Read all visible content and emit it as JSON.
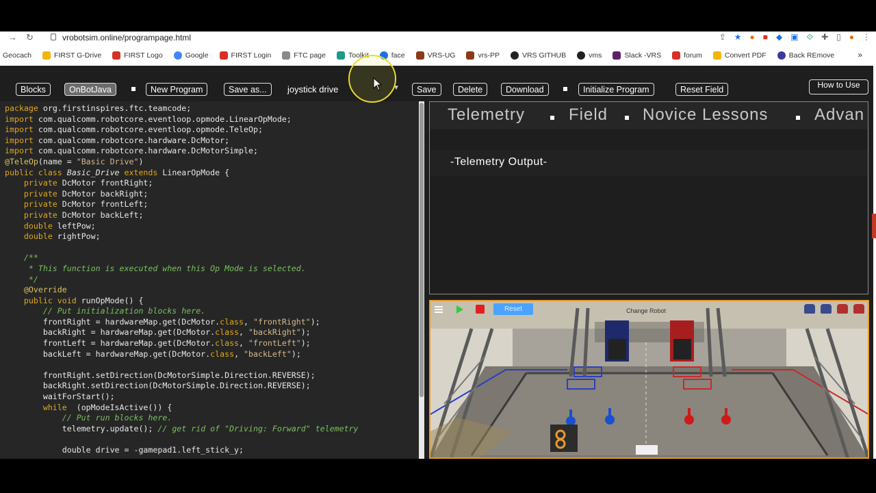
{
  "browser": {
    "url": "vrobotsim.online/programpage.html",
    "bookmarks": [
      {
        "label": "Geocach",
        "color": "#ffffff"
      },
      {
        "label": "FIRST G-Drive",
        "color": "#f4b400"
      },
      {
        "label": "FIRST Logo",
        "color": "#d93025"
      },
      {
        "label": "Google",
        "color": "#4285f4"
      },
      {
        "label": "FIRST Login",
        "color": "#d93025"
      },
      {
        "label": "FTC page",
        "color": "#8a8a8a"
      },
      {
        "label": "Toolkit",
        "color": "#1a9c8c"
      },
      {
        "label": "face",
        "color": "#1a73e8"
      },
      {
        "label": "VRS-UG",
        "color": "#8b3a1a"
      },
      {
        "label": "vrs-PP",
        "color": "#8b3a1a"
      },
      {
        "label": "VRS GITHUB",
        "color": "#222222"
      },
      {
        "label": "vms",
        "color": "#222222"
      },
      {
        "label": "Slack -VRS",
        "color": "#611f69"
      },
      {
        "label": "forum",
        "color": "#d93025"
      },
      {
        "label": "Convert PDF",
        "color": "#f4b400"
      },
      {
        "label": "Back REmove",
        "color": "#3b3b9e"
      }
    ],
    "more": "»"
  },
  "toolbar": {
    "blocks": "Blocks",
    "onbotjava": "OnBotJava",
    "new_program": "New Program",
    "save_as": "Save as...",
    "program_name": "joystick drive",
    "save": "Save",
    "delete": "Delete",
    "download": "Download",
    "initialize": "Initialize Program",
    "reset_field": "Reset Field",
    "how_to_use": "How to Use"
  },
  "tabs": {
    "telemetry": "Telemetry",
    "field": "Field",
    "novice": "Novice Lessons",
    "advanced": "Advan"
  },
  "telemetry_output": "-Telemetry Output-",
  "sim": {
    "reset": "Reset",
    "change_robot": "Change Robot"
  },
  "code": {
    "l1_a": "package",
    "l1_b": " org.firstinspires.ftc.teamcode;",
    "l2_a": "import",
    "l2_b": " com.qualcomm.robotcore.eventloop.opmode.LinearOpMode;",
    "l3_a": "import",
    "l3_b": " com.qualcomm.robotcore.eventloop.opmode.TeleOp;",
    "l4_a": "import",
    "l4_b": " com.qualcomm.robotcore.hardware.DcMotor;",
    "l5_a": "import",
    "l5_b": " com.qualcomm.robotcore.hardware.DcMotorSimple;",
    "l6_a": "@TeleOp",
    "l6_b": "(name = ",
    "l6_c": "\"Basic Drive\"",
    "l6_d": ")",
    "l7_a": "public class",
    "l7_b": " ",
    "l7_c": "Basic_Drive",
    "l7_d": " ",
    "l7_e": "extends",
    "l7_f": " LinearOpMode {",
    "l8_a": "private",
    "l8_b": " DcMotor frontRight;",
    "l9_a": "private",
    "l9_b": " DcMotor backRight;",
    "l10_a": "private",
    "l10_b": " DcMotor frontLeft;",
    "l11_a": "private",
    "l11_b": " DcMotor backLeft;",
    "l12_a": "double",
    "l12_b": " leftPow;",
    "l13_a": "double",
    "l13_b": " rightPow;",
    "l15": "/**",
    "l16": " * This function is executed when this Op Mode is selected.",
    "l17": " */",
    "l18": "@Override",
    "l19_a": "public void",
    "l19_b": " runOpMode() {",
    "l20": "// Put initialization blocks here.",
    "l21_a": "frontRight = hardwareMap.get(DcMotor.",
    "l21_b": "class",
    "l21_c": ", ",
    "l21_d": "\"frontRight\"",
    "l21_e": ");",
    "l22_a": "backRight = hardwareMap.get(DcMotor.",
    "l22_b": "class",
    "l22_c": ", ",
    "l22_d": "\"backRight\"",
    "l22_e": ");",
    "l23_a": "frontLeft = hardwareMap.get(DcMotor.",
    "l23_b": "class",
    "l23_c": ", ",
    "l23_d": "\"frontLeft\"",
    "l23_e": ");",
    "l24_a": "backLeft = hardwareMap.get(DcMotor.",
    "l24_b": "class",
    "l24_c": ", ",
    "l24_d": "\"backLeft\"",
    "l24_e": ");",
    "l26": "frontRight.setDirection(DcMotorSimple.Direction.REVERSE);",
    "l27": "backRight.setDirection(DcMotorSimple.Direction.REVERSE);",
    "l28": "waitForStart();",
    "l29_a": "while",
    "l29_b": "  (opModeIsActive()) {",
    "l30": "// Put run blocks here.",
    "l31_a": "telemetry.update(); ",
    "l31_b": "// get rid of \"Driving: Forward\" telemetry",
    "l33": "double drive = -gamepad1.left_stick_y;"
  }
}
